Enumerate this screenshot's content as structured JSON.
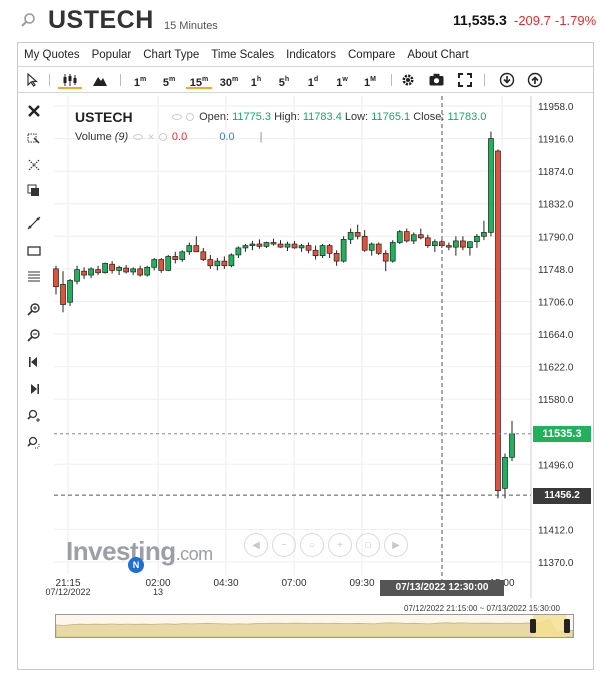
{
  "header": {
    "symbol": "USTECH",
    "interval": "15 Minutes",
    "price": "11,535.3",
    "change": "-209.7",
    "change_pct": "-1.79%"
  },
  "menu": [
    "My Quotes",
    "Popular",
    "Chart Type",
    "Time Scales",
    "Indicators",
    "Compare",
    "About Chart"
  ],
  "toolbar": {
    "timeframes": [
      {
        "num": "1",
        "unit": "m",
        "active": false
      },
      {
        "num": "5",
        "unit": "m",
        "active": false
      },
      {
        "num": "15",
        "unit": "m",
        "active": true
      },
      {
        "num": "30",
        "unit": "m",
        "active": false
      },
      {
        "num": "1",
        "unit": "h",
        "active": false
      },
      {
        "num": "5",
        "unit": "h",
        "active": false
      },
      {
        "num": "1",
        "unit": "d",
        "active": false
      },
      {
        "num": "1",
        "unit": "w",
        "active": false
      },
      {
        "num": "1",
        "unit": "M",
        "active": false
      }
    ]
  },
  "legend": {
    "title": "USTECH",
    "open_label": "Open:",
    "open": "11775.3",
    "high_label": "High:",
    "high": "11783.4",
    "low_label": "Low:",
    "low": "11765.1",
    "close_label": "Close:",
    "close": "11783.0",
    "volume_label": "Volume",
    "volume_period": "(9)",
    "volume_value_1": "0.0",
    "volume_value_2": "0.0"
  },
  "tags": {
    "last_price": "11535.3",
    "crosshair_price": "11456.2",
    "crosshair_time": "07/13/2022 12:30:00"
  },
  "watermark": {
    "brand": "Investing",
    "suffix": ".com",
    "badge": "N"
  },
  "navigator": {
    "range_label": "07/12/2022 21:15:00 ~ 07/13/2022 15:30:00"
  },
  "colors": {
    "up": "#21b15b",
    "down": "#e0533a",
    "accent": "#f5a623",
    "grid": "#eeeeee"
  },
  "chart_data": {
    "type": "candlestick",
    "title": "USTECH",
    "ylim": [
      11370,
      11958
    ],
    "yticks": [
      "11958.0",
      "11916.0",
      "11874.0",
      "11832.0",
      "11790.0",
      "11748.0",
      "11706.0",
      "11664.0",
      "11622.0",
      "11580.0",
      "11496.0",
      "11412.0",
      "11370.0"
    ],
    "xticks": [
      {
        "label": "21:15",
        "sub": "07/12/2022"
      },
      {
        "label": "02:00",
        "sub": "13"
      },
      {
        "label": "04:30",
        "sub": ""
      },
      {
        "label": "07:00",
        "sub": ""
      },
      {
        "label": "09:30",
        "sub": ""
      },
      {
        "label": "15:00",
        "sub": ""
      }
    ],
    "candles": [
      [
        11748,
        11752,
        11715,
        11725
      ],
      [
        11728,
        11745,
        11692,
        11702
      ],
      [
        11705,
        11735,
        11700,
        11733
      ],
      [
        11732,
        11752,
        11728,
        11747
      ],
      [
        11745,
        11750,
        11735,
        11740
      ],
      [
        11740,
        11750,
        11736,
        11748
      ],
      [
        11747,
        11752,
        11740,
        11743
      ],
      [
        11743,
        11756,
        11742,
        11755
      ],
      [
        11754,
        11758,
        11742,
        11746
      ],
      [
        11746,
        11752,
        11740,
        11750
      ],
      [
        11749,
        11753,
        11742,
        11744
      ],
      [
        11744,
        11750,
        11740,
        11748
      ],
      [
        11748,
        11752,
        11738,
        11740
      ],
      [
        11740,
        11752,
        11738,
        11750
      ],
      [
        11750,
        11762,
        11746,
        11760
      ],
      [
        11760,
        11762,
        11743,
        11746
      ],
      [
        11746,
        11766,
        11745,
        11764
      ],
      [
        11764,
        11770,
        11755,
        11760
      ],
      [
        11760,
        11772,
        11757,
        11770
      ],
      [
        11770,
        11782,
        11766,
        11778
      ],
      [
        11778,
        11790,
        11772,
        11770
      ],
      [
        11770,
        11775,
        11758,
        11760
      ],
      [
        11760,
        11766,
        11748,
        11752
      ],
      [
        11752,
        11762,
        11746,
        11758
      ],
      [
        11758,
        11764,
        11748,
        11752
      ],
      [
        11752,
        11768,
        11750,
        11766
      ],
      [
        11766,
        11777,
        11762,
        11775
      ],
      [
        11775,
        11780,
        11770,
        11778
      ],
      [
        11778,
        11784,
        11772,
        11780
      ],
      [
        11780,
        11786,
        11774,
        11777
      ],
      [
        11777,
        11783,
        11775,
        11782
      ],
      [
        11782,
        11787,
        11778,
        11780
      ],
      [
        11780,
        11785,
        11775,
        11776
      ],
      [
        11776,
        11783,
        11771,
        11780
      ],
      [
        11780,
        11784,
        11774,
        11775
      ],
      [
        11775,
        11780,
        11770,
        11778
      ],
      [
        11778,
        11782,
        11768,
        11772
      ],
      [
        11772,
        11778,
        11760,
        11765
      ],
      [
        11765,
        11780,
        11762,
        11778
      ],
      [
        11778,
        11780,
        11762,
        11768
      ],
      [
        11768,
        11772,
        11752,
        11758
      ],
      [
        11758,
        11790,
        11756,
        11786
      ],
      [
        11786,
        11800,
        11780,
        11795
      ],
      [
        11795,
        11805,
        11786,
        11790
      ],
      [
        11790,
        11798,
        11770,
        11772
      ],
      [
        11772,
        11782,
        11765,
        11780
      ],
      [
        11780,
        11782,
        11766,
        11768
      ],
      [
        11768,
        11772,
        11745,
        11758
      ],
      [
        11758,
        11785,
        11756,
        11782
      ],
      [
        11782,
        11798,
        11780,
        11796
      ],
      [
        11796,
        11800,
        11782,
        11784
      ],
      [
        11784,
        11795,
        11780,
        11792
      ],
      [
        11792,
        11800,
        11786,
        11788
      ],
      [
        11788,
        11792,
        11775,
        11778
      ],
      [
        11778,
        11786,
        11770,
        11783
      ],
      [
        11783,
        11786,
        11775,
        11778
      ],
      [
        11778,
        11782,
        11772,
        11776
      ],
      [
        11776,
        11790,
        11765,
        11784
      ],
      [
        11784,
        11790,
        11772,
        11776
      ],
      [
        11775.3,
        11783.4,
        11765.1,
        11783.0
      ],
      [
        11783,
        11793,
        11775,
        11790
      ],
      [
        11790,
        11810,
        11785,
        11795
      ],
      [
        11795,
        11925,
        11790,
        11916
      ],
      [
        11900,
        11902,
        11452,
        11462
      ],
      [
        11465,
        11510,
        11452,
        11505
      ],
      [
        11505,
        11552,
        11500,
        11535.3
      ]
    ],
    "last_price": 11535.3,
    "crosshair_price": 11456.2,
    "crosshair_time": "07/13/2022 12:30:00"
  }
}
